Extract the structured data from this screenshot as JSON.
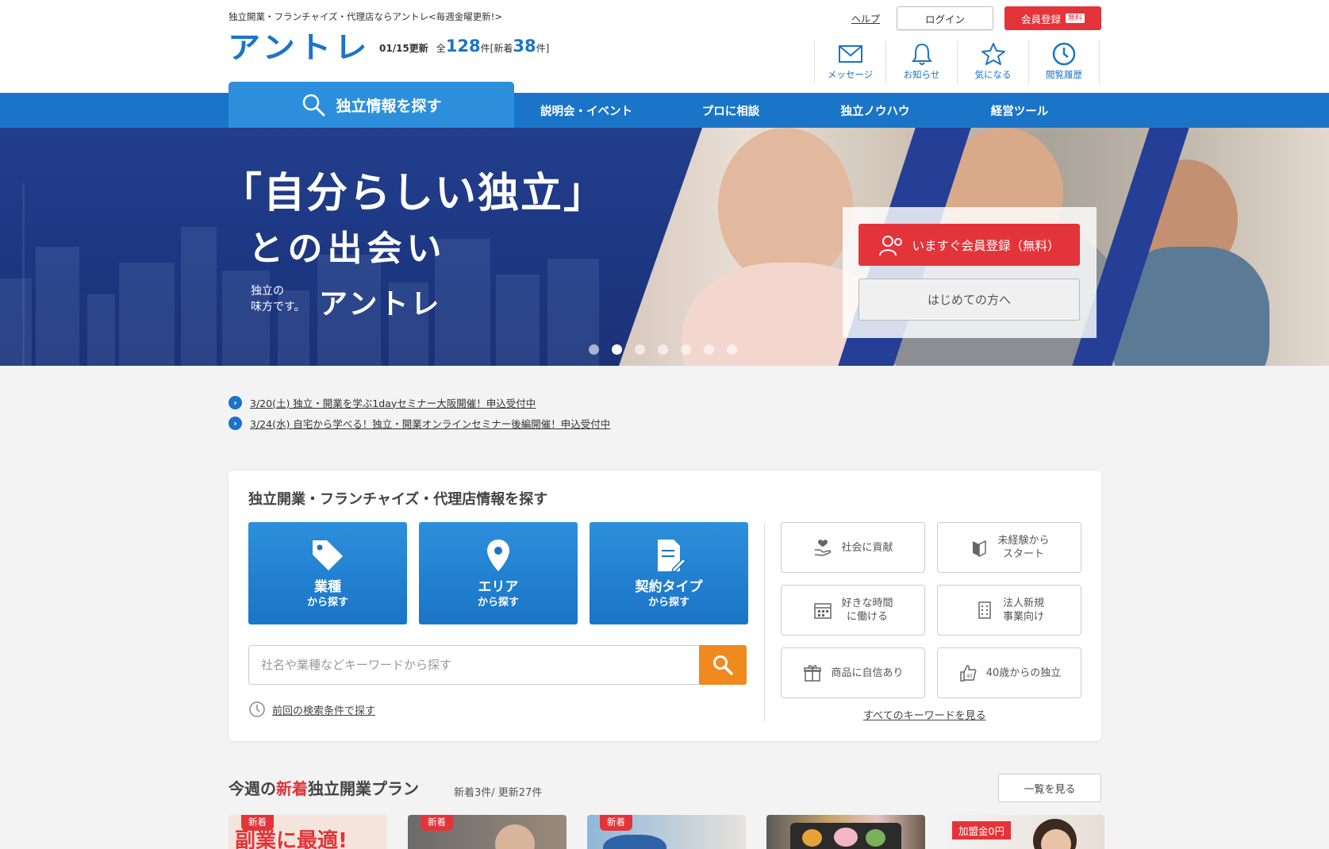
{
  "header": {
    "tagline": "独立開業・フランチャイズ・代理店ならアントレ<毎週金曜更新!>",
    "logo": "アントレ",
    "update_date": "01/15更新",
    "total_prefix": "全",
    "total_count": "128",
    "total_unit": "件[新着",
    "new_count": "38",
    "new_unit": "件]",
    "help": "ヘルプ",
    "login": "ログイン",
    "register": "会員登録",
    "register_badge": "無料",
    "icons": [
      {
        "label": "メッセージ",
        "icon": "mail-icon"
      },
      {
        "label": "お知らせ",
        "icon": "bell-icon"
      },
      {
        "label": "気になる",
        "icon": "star-icon"
      },
      {
        "label": "閲覧履歴",
        "icon": "clock-icon"
      }
    ]
  },
  "nav": {
    "search": "独立情報を探す",
    "links": [
      "説明会・イベント",
      "プロに相談",
      "独立ノウハウ",
      "経営ツール"
    ]
  },
  "hero": {
    "title1": "「自分らしい独立」",
    "title2": "との出会い",
    "sub1": "独立の",
    "sub2": "味方です。",
    "logo": "アントレ",
    "cta": "いますぐ会員登録（無料）",
    "first": "はじめての方へ",
    "slide_count": 7,
    "active_slide": 2
  },
  "news": [
    "3/20(土) 独立・開業を学ぶ1dayセミナー大阪開催！申込受付中",
    "3/24(水) 自宅から学べる！独立・開業オンラインセミナー後編開催！申込受付中"
  ],
  "search": {
    "title": "独立開業・フランチャイズ・代理店情報を探す",
    "buttons": [
      {
        "main": "業種",
        "sub": "から探す",
        "icon": "tag-icon"
      },
      {
        "main": "エリア",
        "sub": "から探す",
        "icon": "pin-icon"
      },
      {
        "main": "契約タイプ",
        "sub": "から探す",
        "icon": "document-icon"
      }
    ],
    "placeholder": "社名や業種などキーワードから探す",
    "prev": "前回の検索条件で探す",
    "keywords": [
      {
        "label": "社会に貢献",
        "icon": "heart-hand-icon"
      },
      {
        "label": "未経験から\nスタート",
        "icon": "beginner-mark-icon"
      },
      {
        "label": "好きな時間\nに働ける",
        "icon": "calendar-icon"
      },
      {
        "label": "法人新規\n事業向け",
        "icon": "building-icon"
      },
      {
        "label": "商品に自信あり",
        "icon": "gift-icon"
      },
      {
        "label": "40歳からの独立",
        "icon": "thumbs-up-40-icon"
      }
    ],
    "all_keywords": "すべてのキーワードを見る"
  },
  "plans": {
    "title_pre": "今週の",
    "title_new": "新着",
    "title_post": "独立開業プラン",
    "count": "新着3件/ 更新27件",
    "list_btn": "一覧を見る",
    "badge_new": "新着",
    "badge_fee": "加盟金0円",
    "card1_text": "副業に最適!"
  },
  "colors": {
    "brand_blue": "#1a74c7",
    "accent_red": "#e3343a",
    "accent_orange": "#f08a1e"
  }
}
